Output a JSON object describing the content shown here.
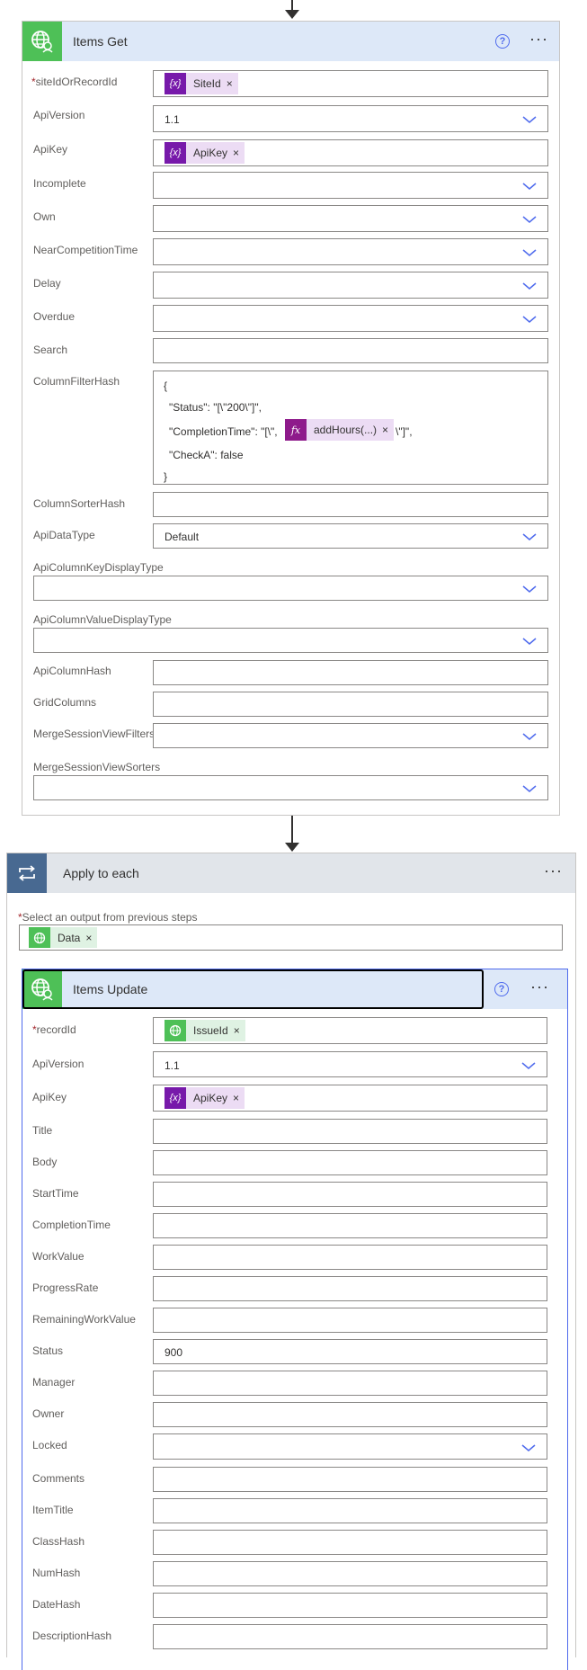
{
  "colors": {
    "accent": "#4f6bed",
    "header_bg": "#dde8f8",
    "loop_header": "#e1e5ea",
    "loop_icon": "#486991",
    "green": "#4ec057",
    "var_purple": "#7719aa",
    "expr_purple": "#8e1a8b",
    "chip_var": "#ecdcf4",
    "chip_data": "#dff2e3"
  },
  "items_get": {
    "title": "Items Get",
    "fields": {
      "siteIdOrRecordId": {
        "label": "siteIdOrRecordId",
        "token": "SiteId"
      },
      "ApiVersion": {
        "label": "ApiVersion",
        "value": "1.1"
      },
      "ApiKey": {
        "label": "ApiKey",
        "token": "ApiKey"
      },
      "Incomplete": {
        "label": "Incomplete"
      },
      "Own": {
        "label": "Own"
      },
      "NearCompetitionTime": {
        "label": "NearCompetitionTime"
      },
      "Delay": {
        "label": "Delay"
      },
      "Overdue": {
        "label": "Overdue"
      },
      "Search": {
        "label": "Search"
      },
      "ColumnFilterHash": {
        "label": "ColumnFilterHash",
        "line1": "{",
        "line2": "\"Status\": \"[\\\"200\\\"]\",",
        "line3_pre": "\"CompletionTime\": \"[\\\",",
        "line3_token": "addHours(...)",
        "line3_post": "\\\"]\",",
        "line4": "\"CheckA\": false",
        "line5": "}"
      },
      "ColumnSorterHash": {
        "label": "ColumnSorterHash"
      },
      "ApiDataType": {
        "label": "ApiDataType",
        "value": "Default"
      },
      "ApiColumnKeyDisplayType": {
        "label": "ApiColumnKeyDisplayType"
      },
      "ApiColumnValueDisplayType": {
        "label": "ApiColumnValueDisplayType"
      },
      "ApiColumnHash": {
        "label": "ApiColumnHash"
      },
      "GridColumns": {
        "label": "GridColumns"
      },
      "MergeSessionViewFilters": {
        "label": "MergeSessionViewFilters"
      },
      "MergeSessionViewSorters": {
        "label": "MergeSessionViewSorters"
      }
    }
  },
  "apply_each": {
    "title": "Apply to each",
    "select_label": "Select an output from previous steps",
    "token": "Data"
  },
  "items_update": {
    "title": "Items Update",
    "fields": {
      "recordId": {
        "label": "recordId",
        "token": "IssueId"
      },
      "ApiVersion": {
        "label": "ApiVersion",
        "value": "1.1"
      },
      "ApiKey": {
        "label": "ApiKey",
        "token": "ApiKey"
      },
      "Title": {
        "label": "Title"
      },
      "Body": {
        "label": "Body"
      },
      "StartTime": {
        "label": "StartTime"
      },
      "CompletionTime": {
        "label": "CompletionTime"
      },
      "WorkValue": {
        "label": "WorkValue"
      },
      "ProgressRate": {
        "label": "ProgressRate"
      },
      "RemainingWorkValue": {
        "label": "RemainingWorkValue"
      },
      "Status": {
        "label": "Status",
        "value": "900"
      },
      "Manager": {
        "label": "Manager"
      },
      "Owner": {
        "label": "Owner"
      },
      "Locked": {
        "label": "Locked"
      },
      "Comments": {
        "label": "Comments"
      },
      "ItemTitle": {
        "label": "ItemTitle"
      },
      "ClassHash": {
        "label": "ClassHash"
      },
      "NumHash": {
        "label": "NumHash"
      },
      "DateHash": {
        "label": "DateHash"
      },
      "DescriptionHash": {
        "label": "DescriptionHash"
      }
    }
  },
  "icons": {
    "more": "more-options-icon",
    "help": "help-icon",
    "chevron": "chevron-down-icon",
    "remove": "remove-token-icon",
    "globe": "globe-connector-icon",
    "loop": "loop-icon",
    "variable": "variable-icon",
    "expression": "expression-fx-icon"
  }
}
